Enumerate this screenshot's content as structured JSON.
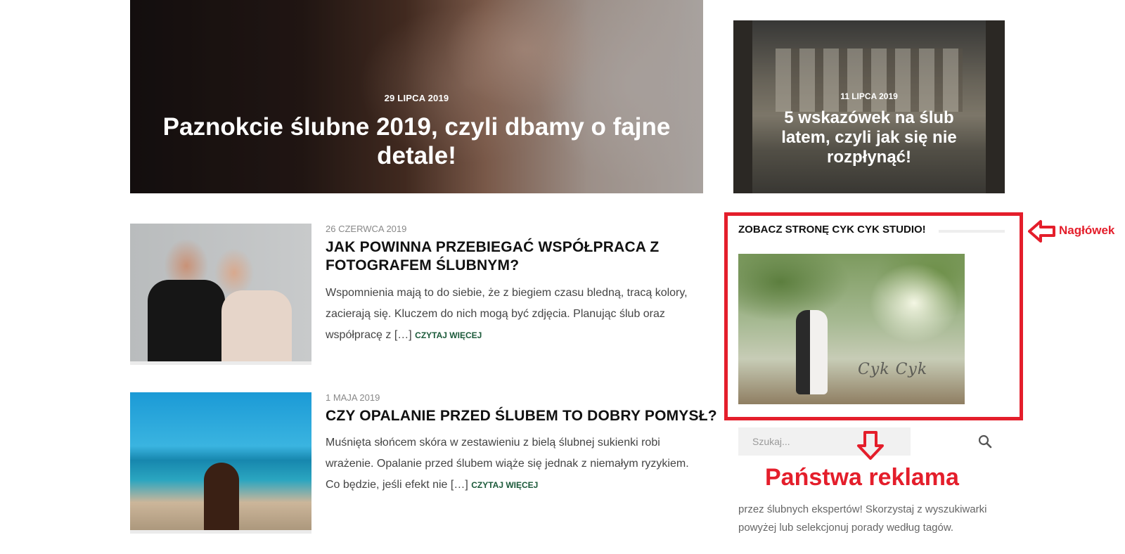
{
  "featured": {
    "main": {
      "date": "29 LIPCA 2019",
      "title": "Paznokcie ślubne 2019, czyli dbamy o fajne detale!"
    },
    "side": {
      "date": "11 LIPCA 2019",
      "title": "5 wskazówek na ślub latem, czyli jak się nie rozpłynąć!"
    }
  },
  "posts": [
    {
      "date": "26 CZERWCA 2019",
      "title": "JAK POWINNA PRZEBIEGAĆ WSPÓŁPRACA Z FOTOGRAFEM ŚLUBNYM?",
      "excerpt": "Wspomnienia mają to do siebie, że z biegiem czasu bledną, tracą kolory, zacierają się. Kluczem do nich mogą być zdjęcia. Planując ślub oraz współpracę z […]",
      "read_more": "CZYTAJ WIĘCEJ"
    },
    {
      "date": "1 MAJA 2019",
      "title": "CZY OPALANIE PRZED ŚLUBEM TO DOBRY POMYSŁ?",
      "excerpt": "Muśnięta słońcem skóra w zestawieniu z bielą ślubnej sukienki robi wrażenie. Opalanie przed ślubem wiąże się jednak z niemałym ryzykiem. Co będzie, jeśli efekt nie […]",
      "read_more": "CZYTAJ WIĘCEJ"
    }
  ],
  "sidebar": {
    "widget_heading": "ZOBACZ STRONĘ CYK CYK STUDIO!",
    "widget_image_signature": "Cyk Cyk",
    "search_placeholder": "Szukaj...",
    "about_text": "przez ślubnych ekspertów! Skorzystaj z wyszukiwarki powyżej lub selekcjonuj porady według tagów."
  },
  "annotations": {
    "header_label": "Nagłówek",
    "ad_label": "Państwa reklama",
    "color": "#e41e2b"
  },
  "icons": {
    "search": "search-icon",
    "arrow_left": "arrow-left-icon",
    "arrow_down": "arrow-down-icon"
  }
}
